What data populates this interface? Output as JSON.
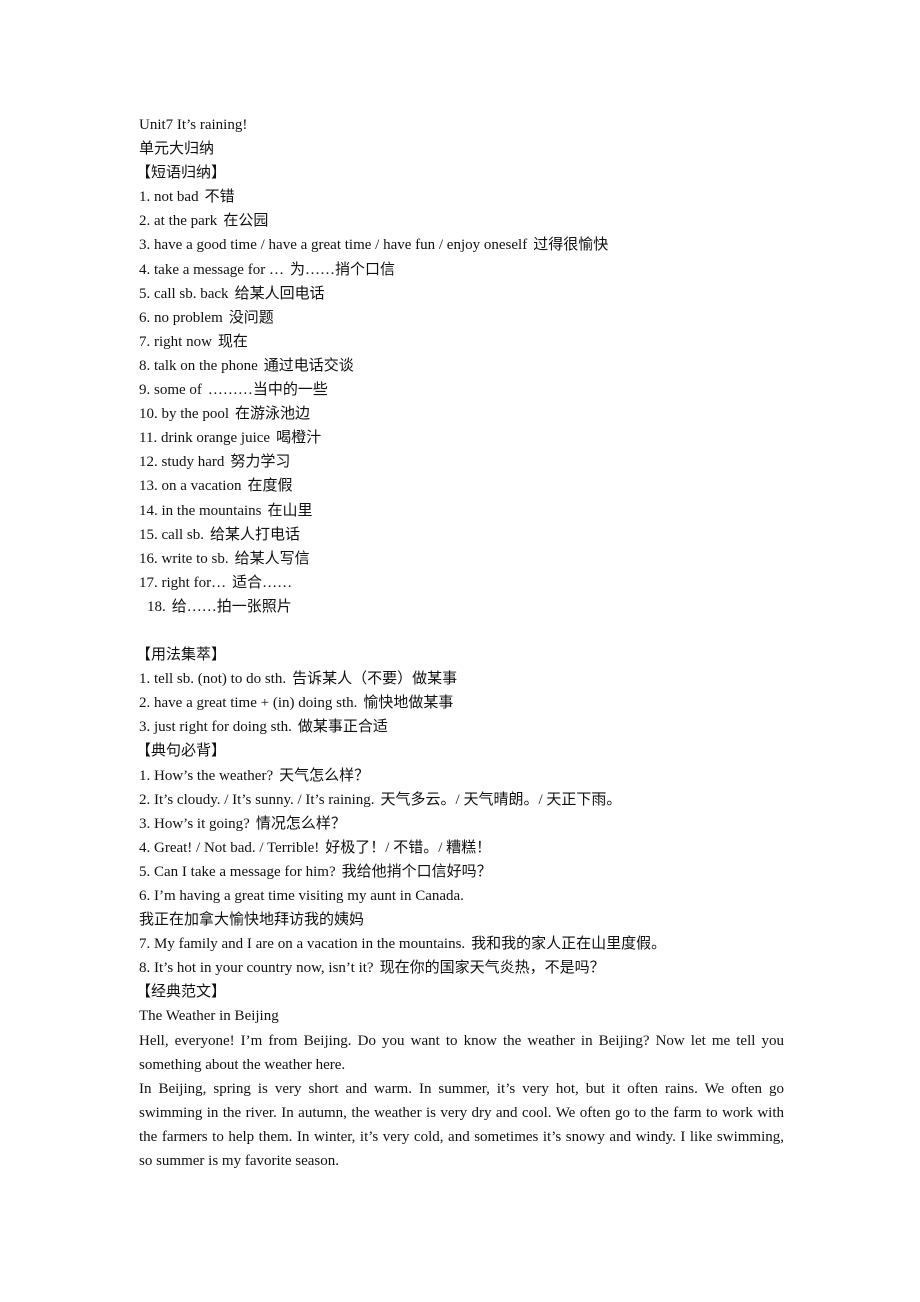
{
  "title": "Unit7 It’s raining!",
  "subtitle": "单元大归纳",
  "phrases": {
    "heading": "【短语归纳】",
    "items": [
      {
        "en": "1. not bad",
        "zh": "不错"
      },
      {
        "en": "2. at the park",
        "zh": "在公园"
      },
      {
        "en": "3. have a good time / have a great time / have fun / enjoy oneself",
        "zh": "过得很愉快"
      },
      {
        "en": "4. take a message for …",
        "zh": "为……捎个口信"
      },
      {
        "en": "5. call sb. back",
        "zh": "给某人回电话"
      },
      {
        "en": "6. no problem",
        "zh": "没问题"
      },
      {
        "en": "7. right now",
        "zh": "现在"
      },
      {
        "en": "8. talk on the phone",
        "zh": "通过电话交谈"
      },
      {
        "en": "9. some of",
        "zh": "………当中的一些"
      },
      {
        "en": "10. by the pool",
        "zh": "在游泳池边"
      },
      {
        "en": "11. drink orange juice",
        "zh": "喝橙汁"
      },
      {
        "en": "12. study hard",
        "zh": "努力学习"
      },
      {
        "en": "13. on a vacation",
        "zh": "在度假"
      },
      {
        "en": "14. in the mountains",
        "zh": "在山里"
      },
      {
        "en": "15. call sb.",
        "zh": "给某人打电话"
      },
      {
        "en": "16. write to sb.",
        "zh": "给某人写信"
      },
      {
        "en": "17. right for…",
        "zh": "适合……"
      },
      {
        "en": "18.",
        "zh": "给……拍一张照片"
      }
    ]
  },
  "usage": {
    "heading": "【用法集萃】",
    "items": [
      {
        "en": "1. tell sb. (not) to do sth.",
        "zh": "告诉某人（不要）做某事"
      },
      {
        "en": "2. have a great time + (in) doing sth.",
        "zh": "愉快地做某事"
      },
      {
        "en": "3. just right for doing sth.",
        "zh": "做某事正合适"
      }
    ]
  },
  "sentences": {
    "heading": "【典句必背】",
    "items": [
      {
        "en": "1. How’s the weather?",
        "zh": "天气怎么样？"
      },
      {
        "en": "2. It’s cloudy. / It’s sunny. / It’s raining.",
        "zh": "天气多云。/ 天气晴朗。/ 天正下雨。"
      },
      {
        "en": "3. How’s it going?",
        "zh": "情况怎么样？"
      },
      {
        "en": "4. Great! / Not bad. / Terrible!",
        "zh": "好极了！/ 不错。/ 糟糕！"
      },
      {
        "en": "5. Can I take a message for him?",
        "zh": "我给他捎个口信好吗？"
      },
      {
        "en": "6. I’m having a great time visiting my aunt in Canada.",
        "zh": ""
      },
      {
        "en": "",
        "zh": "我正在加拿大愉快地拜访我的姨妈"
      },
      {
        "en": "7. My family and I are on a vacation in the mountains.",
        "zh": "我和我的家人正在山里度假。"
      },
      {
        "en": "8. It’s hot in your country now, isn’t it?",
        "zh": "现在你的国家天气炎热，不是吗？"
      }
    ]
  },
  "essay": {
    "heading": "【经典范文】",
    "title": "The Weather in Beijing",
    "paragraphs": [
      "Hell, everyone! I’m from Beijing. Do you want to know the weather in Beijing? Now let me tell you something about the weather here.",
      "In Beijing, spring is very short and warm. In summer, it’s very hot, but it often rains. We often go swimming in the river. In autumn, the weather is very dry and cool. We often go to the farm to work with the farmers to help them. In winter, it’s very cold, and sometimes it’s snowy and windy. I like swimming, so summer is my favorite season."
    ]
  }
}
